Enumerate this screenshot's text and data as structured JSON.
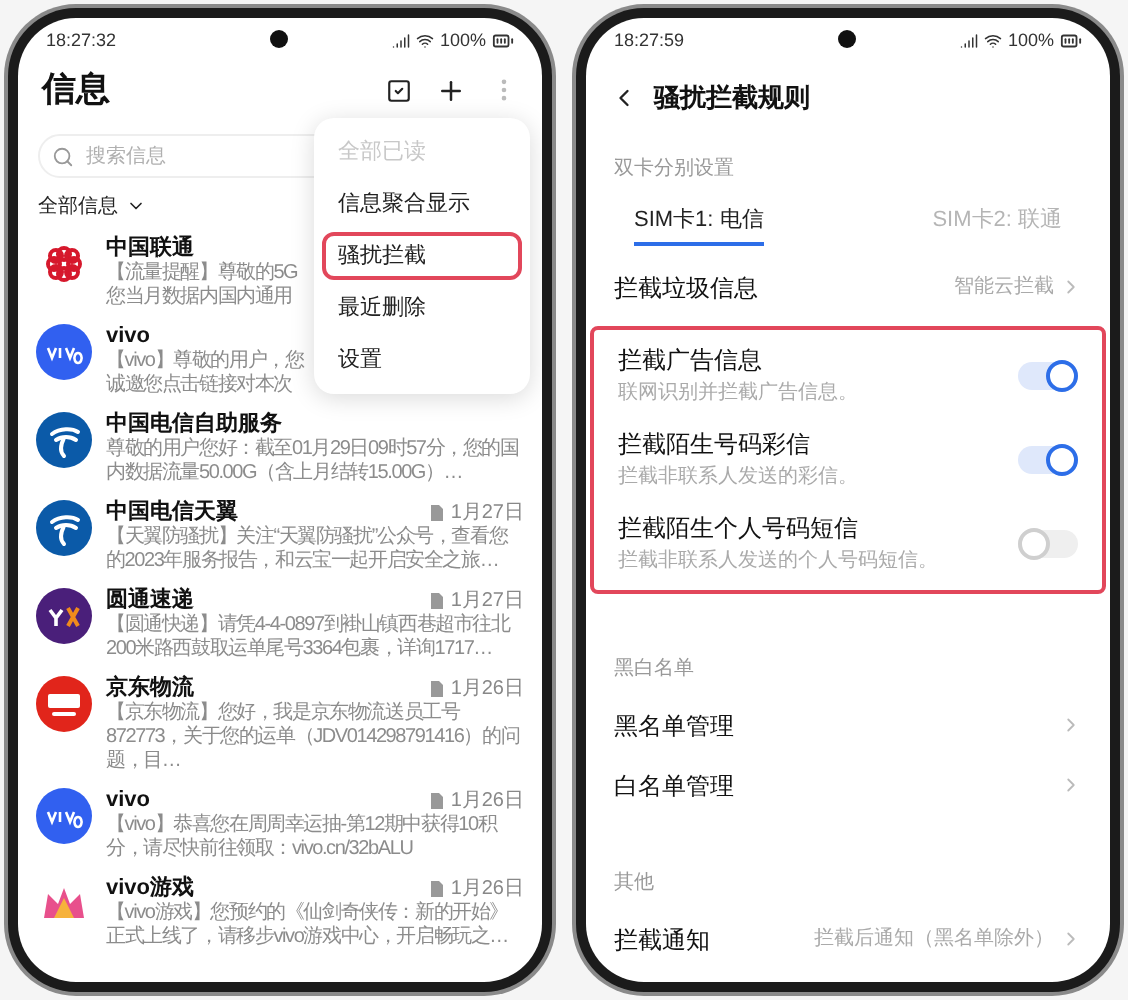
{
  "left_screen": {
    "status_bar": {
      "time": "18:27:32",
      "battery": "100%"
    },
    "title": "信息",
    "search": {
      "placeholder": "搜索信息"
    },
    "filter": "全部信息",
    "messages": [
      {
        "sender": "中国联通",
        "kind": "unicom",
        "preview": "【流量提醒】尊敬的5G您当月数据内国内通用",
        "under_menu": true
      },
      {
        "sender": "vivo",
        "kind": "vivo",
        "preview": "【vivo】尊敬的用户，您诚邀您点击链接对本次",
        "under_menu": true
      },
      {
        "sender": "中国电信自助服务",
        "kind": "telecom",
        "preview": "尊敬的用户您好：截至01月29日09时57分，您的国内数据流量50.00G（含上月结转15.00G）…",
        "under_menu": false
      },
      {
        "sender": "中国电信天翼",
        "kind": "telecom",
        "date": "1月27日",
        "preview": "【天翼防骚扰】关注“天翼防骚扰”公众号，查看您的2023年服务报告，和云宝一起开启安全之旅…",
        "under_menu": false
      },
      {
        "sender": "圆通速递",
        "kind": "yto",
        "date": "1月27日",
        "preview": "【圆通快递】请凭4-4-0897到褂山镇西巷超市往北200米路西鼓取运单尾号3364包裹，详询1717…",
        "under_menu": false
      },
      {
        "sender": "京东物流",
        "kind": "jdl",
        "date": "1月26日",
        "preview": "【京东物流】您好，我是京东物流送员工号872773，关于您的运单（JDV014298791416）的问题，目…",
        "under_menu": false
      },
      {
        "sender": "vivo",
        "kind": "vivo",
        "date": "1月26日",
        "preview": "【vivo】恭喜您在周周幸运抽-第12期中获得10积分，请尽快前往领取：vivo.cn/32bALU",
        "under_menu": false
      },
      {
        "sender": "vivo游戏",
        "kind": "game",
        "date": "1月26日",
        "preview": "【vivo游戏】您预约的《仙剑奇侠传：新的开始》正式上线了，请移步vivo游戏中心，开启畅玩之…",
        "under_menu": false
      }
    ],
    "menu": {
      "items": [
        {
          "label": "全部已读",
          "disabled": true,
          "selected": false
        },
        {
          "label": "信息聚合显示",
          "disabled": false,
          "selected": false
        },
        {
          "label": "骚扰拦截",
          "disabled": false,
          "selected": true
        },
        {
          "label": "最近删除",
          "disabled": false,
          "selected": false
        },
        {
          "label": "设置",
          "disabled": false,
          "selected": false
        }
      ]
    }
  },
  "right_screen": {
    "status_bar": {
      "time": "18:27:59",
      "battery": "100%"
    },
    "title": "骚扰拦截规则",
    "dual_sim_label": "双卡分别设置",
    "sim_tabs": [
      {
        "label": "SIM卡1: 电信",
        "selected": true
      },
      {
        "label": "SIM卡2: 联通",
        "selected": false
      }
    ],
    "spam_filter": {
      "label": "拦截垃圾信息",
      "value": "智能云拦截"
    },
    "toggles": [
      {
        "label": "拦截广告信息",
        "description": "联网识别并拦截广告信息。",
        "on": true
      },
      {
        "label": "拦截陌生号码彩信",
        "description": "拦截非联系人发送的彩信。",
        "on": true
      },
      {
        "label": "拦截陌生个人号码短信",
        "description": "拦截非联系人发送的个人号码短信。",
        "on": false
      }
    ],
    "lists_label": "黑白名单",
    "list_items": [
      "黑名单管理",
      "白名单管理"
    ],
    "other_label": "其他",
    "notification": {
      "label": "拦截通知",
      "value": "拦截后通知（黑名单除外）"
    }
  }
}
